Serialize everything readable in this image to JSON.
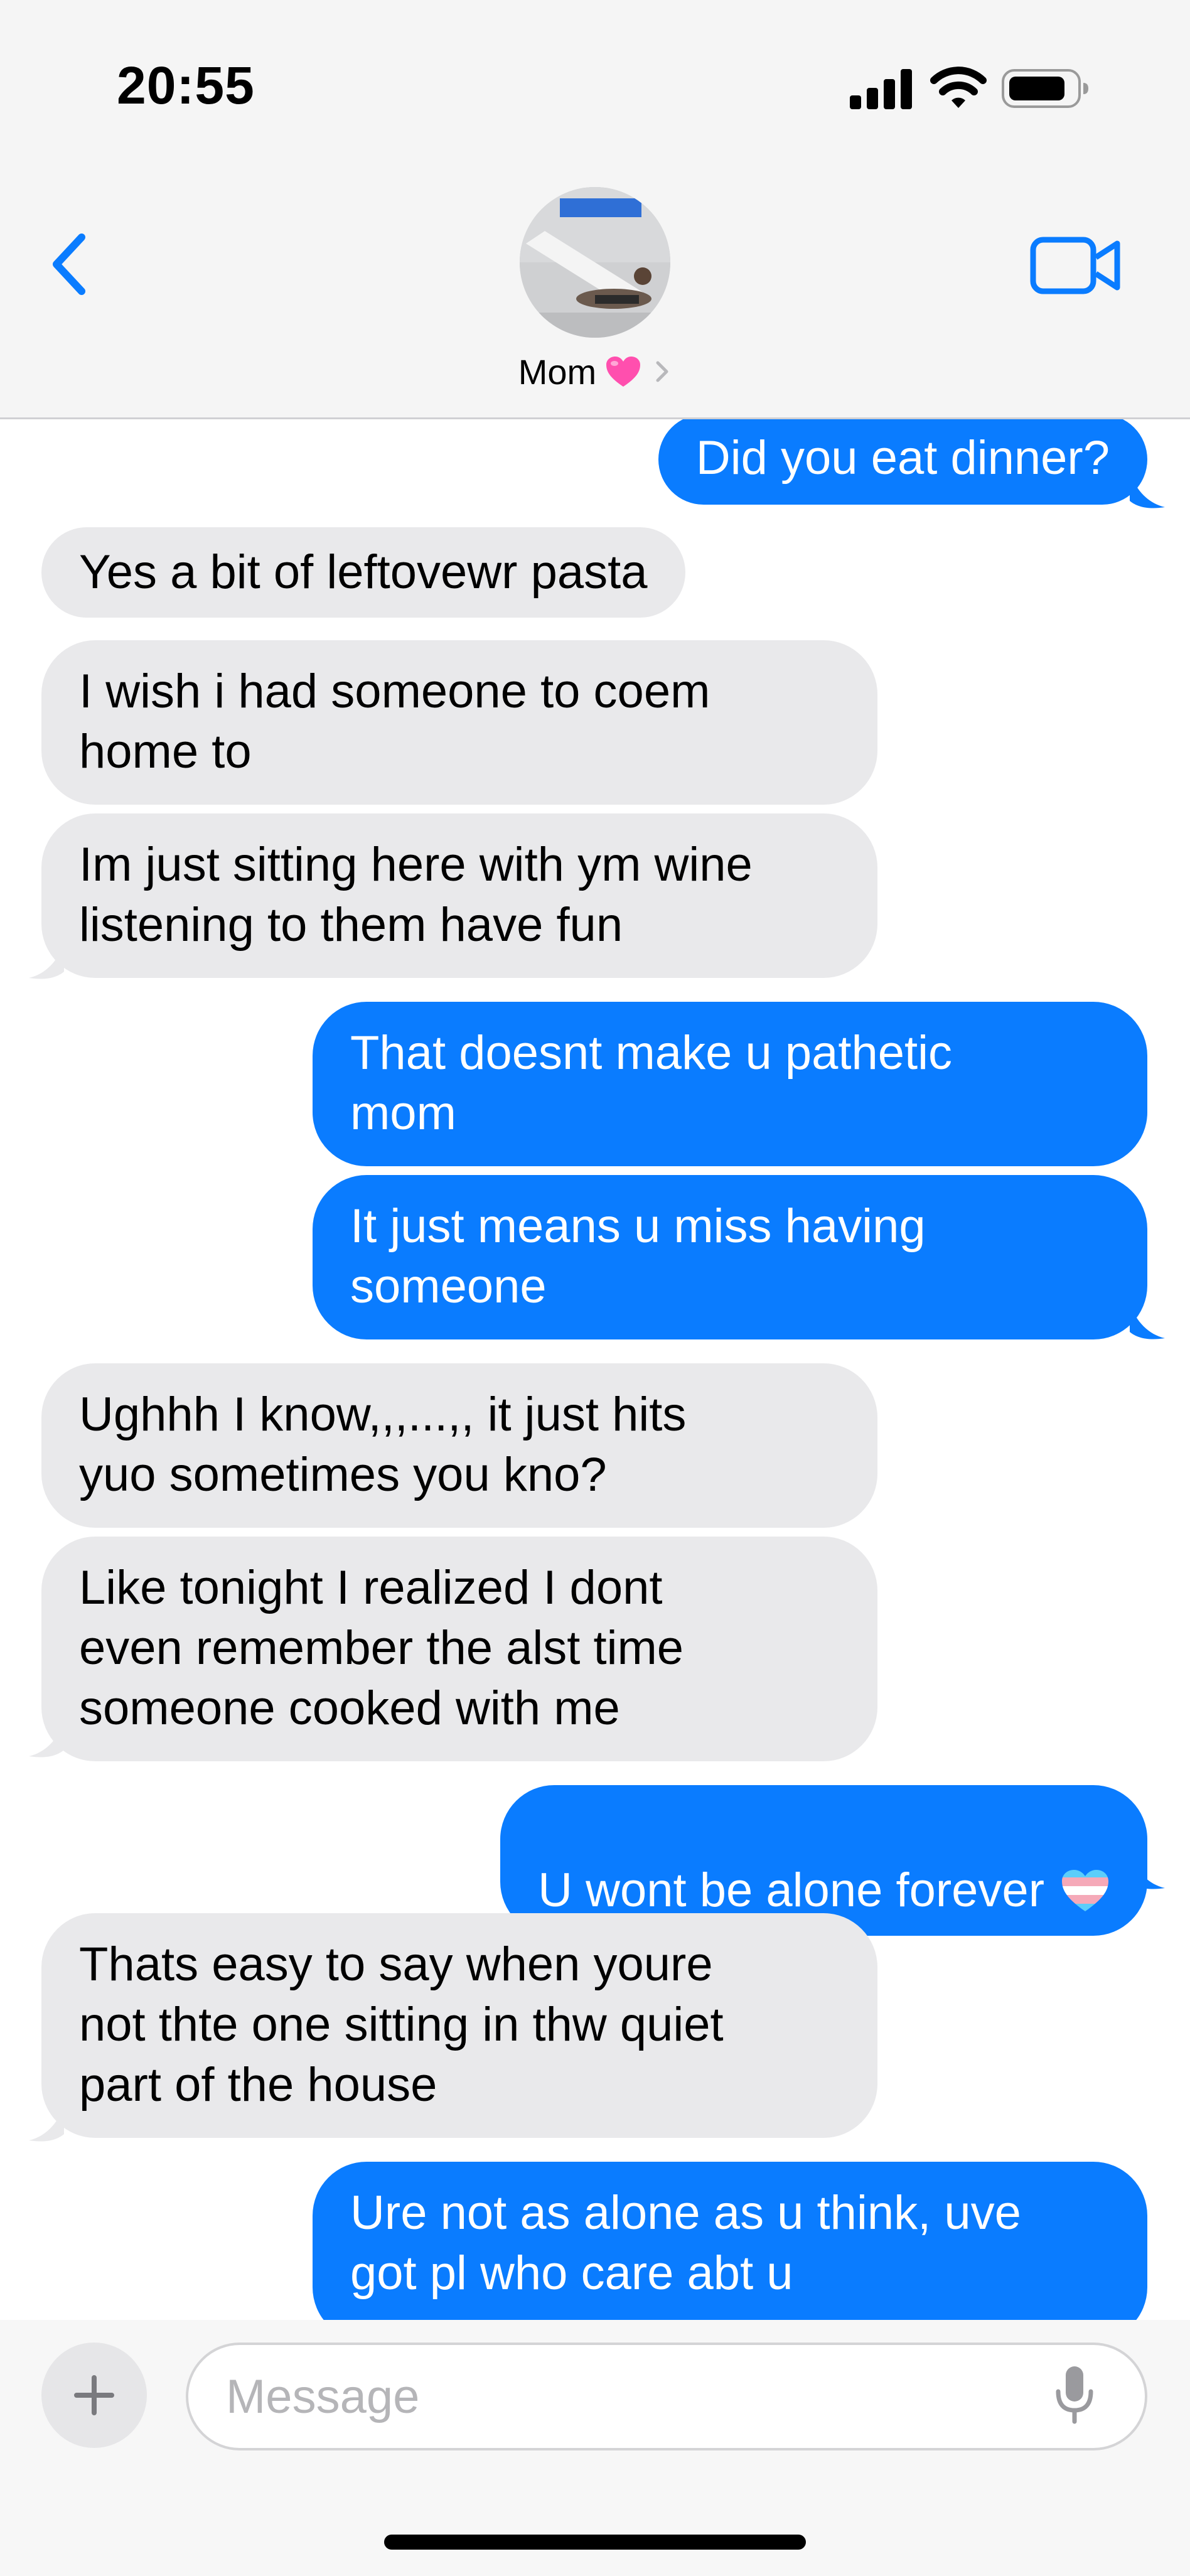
{
  "status_bar": {
    "time": "20:55",
    "icons": [
      "cellular-signal-icon",
      "wifi-icon",
      "battery-icon"
    ]
  },
  "header": {
    "back_icon": "chevron-left-icon",
    "video_icon": "video-camera-icon",
    "contact_name": "Mom",
    "name_emoji": "pink-heart-icon",
    "name_chevron": "chevron-right-icon",
    "avatar": "contact-photo"
  },
  "messages": [
    {
      "sender": "me",
      "text": "Did you eat dinner?"
    },
    {
      "sender": "them",
      "text": "Yes a bit of leftovewr pasta"
    },
    {
      "sender": "them",
      "text": "I wish i had someone to coem\nhome to"
    },
    {
      "sender": "them",
      "text": "Im just sitting here with ym wine\nlistening to them have fun"
    },
    {
      "sender": "me",
      "text": "That doesnt make u pathetic\nmom"
    },
    {
      "sender": "me",
      "text": "It just means u miss having\nsomeone"
    },
    {
      "sender": "them",
      "text": "Ughhh I know,,,...,, it just hits\nyuo sometimes you kno?"
    },
    {
      "sender": "them",
      "text": "Like tonight I realized I dont\neven remember the alst time\nsomeone cooked with me"
    },
    {
      "sender": "me",
      "text": "U wont be alone forever",
      "emoji": "transgender-heart-icon"
    },
    {
      "sender": "them",
      "text": "Thats easy to say when youre\nnot thte one sitting in thw quiet\npart of the house"
    },
    {
      "sender": "me",
      "text": "Ure not as alone as u think, uve\ngot pl who care abt u"
    }
  ],
  "composer": {
    "plus_icon": "plus-icon",
    "placeholder": "Message",
    "mic_icon": "microphone-icon"
  },
  "colors": {
    "sent_bubble": "#0A7CFF",
    "received_bubble": "#E9E9EB",
    "accent": "#0A7CFF",
    "header_bg": "#F5F5F5"
  }
}
